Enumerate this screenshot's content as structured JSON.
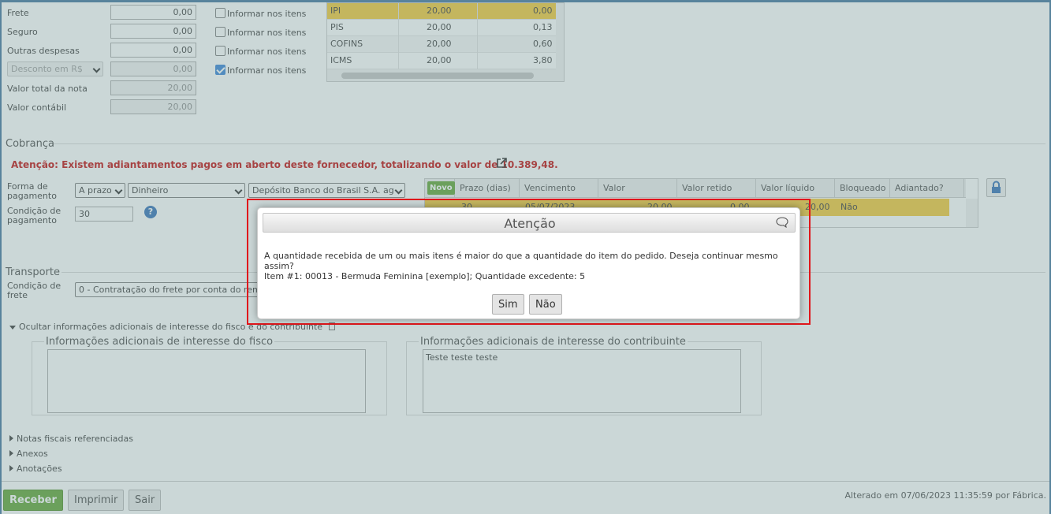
{
  "totals": {
    "rows": [
      {
        "label": "Frete",
        "value": "0,00",
        "check_label": "Informar nos itens",
        "checked": false
      },
      {
        "label": "Seguro",
        "value": "0,00",
        "check_label": "Informar nos itens",
        "checked": false
      },
      {
        "label": "Outras despesas",
        "value": "0,00",
        "check_label": "Informar nos itens",
        "checked": false
      },
      {
        "label": "Desconto em R$",
        "value": "0,00",
        "check_label": "Informar nos itens",
        "checked": true
      },
      {
        "label": "Valor total da nota",
        "value": "20,00"
      },
      {
        "label": "Valor contábil",
        "value": "20,00"
      }
    ]
  },
  "taxes": [
    {
      "name": "IPI",
      "rate": "20,00",
      "value": "0,00"
    },
    {
      "name": "PIS",
      "rate": "20,00",
      "value": "0,13"
    },
    {
      "name": "COFINS",
      "rate": "20,00",
      "value": "0,60"
    },
    {
      "name": "ICMS",
      "rate": "20,00",
      "value": "3,80"
    }
  ],
  "cobranca": {
    "title": "Cobrança",
    "warning": "Atenção: Existem adiantamentos pagos em aberto deste fornecedor, totalizando o valor de 10.389,48.",
    "forma_label": "Forma de pagamento",
    "forma_value": "A prazo",
    "meio_value": "Dinheiro",
    "conta_value": "Depósito Banco do Brasil S.A. ag",
    "condicao_label": "Condição de pagamento",
    "condicao_value": "30",
    "grid": {
      "novo_label": "Novo",
      "headers": [
        "Prazo (dias)",
        "Vencimento",
        "Valor",
        "Valor retido",
        "Valor líquido",
        "Bloqueado",
        "Adiantado?"
      ],
      "row": [
        "30",
        "05/07/2023",
        "20,00",
        "0,00",
        "20,00",
        "Não",
        ""
      ]
    }
  },
  "transporte": {
    "title": "Transporte",
    "condicao_label": "Condição de frete",
    "condicao_value": "0 - Contratação do frete por conta do remetente (CIF)"
  },
  "info": {
    "toggle_label": "Ocultar informações adicionais de interesse do fisco e do contribuinte",
    "fisco_legend": "Informações adicionais de interesse do fisco",
    "fisco_value": "",
    "contrib_legend": "Informações adicionais de interesse do contribuinte",
    "contrib_value": "Teste teste teste"
  },
  "collapsibles": [
    "Notas fiscais referenciadas",
    "Anexos",
    "Anotações"
  ],
  "footer": {
    "receber": "Receber",
    "imprimir": "Imprimir",
    "sair": "Sair",
    "status": "Alterado em 07/06/2023 11:35:59 por Fábrica."
  },
  "modal": {
    "title": "Atenção",
    "message": "A quantidade recebida de um ou mais itens é maior do que a quantidade do item do pedido. Deseja continuar mesmo assim?",
    "detail": "Item #1: 00013 - Bermuda Feminina [exemplo]; Quantidade excedente: 5",
    "yes": "Sim",
    "no": "Não"
  },
  "colors": {
    "accent_green": "#5aa02c",
    "highlight_yellow": "#f3c72f",
    "warning_red": "#c00000",
    "frame_blue": "#3a6f9a"
  }
}
